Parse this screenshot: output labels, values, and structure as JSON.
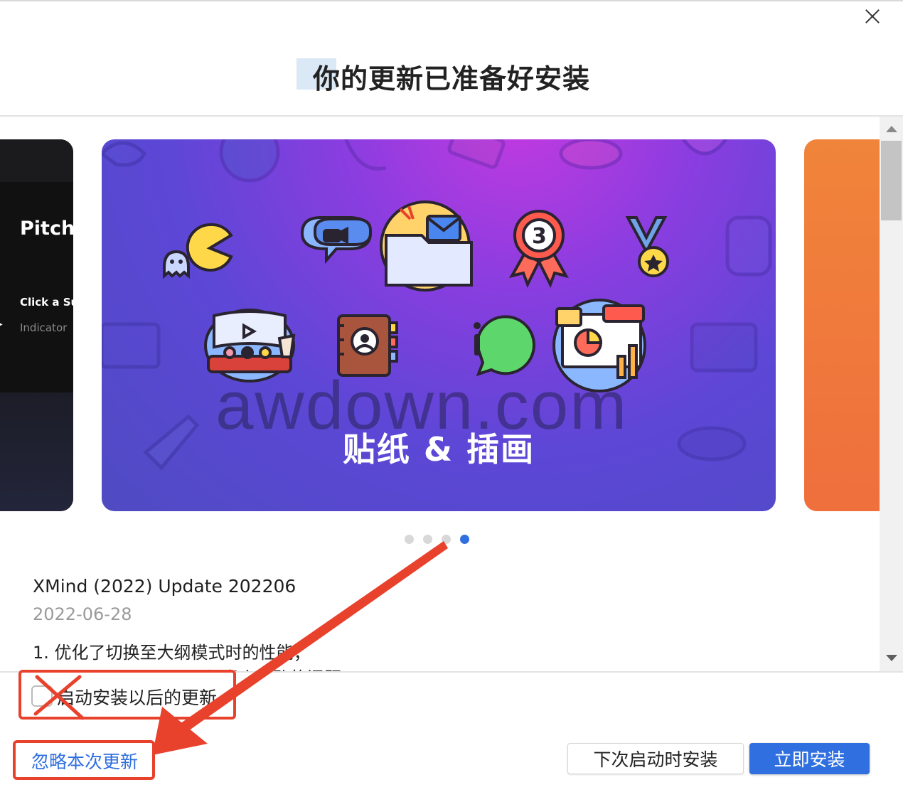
{
  "dialog": {
    "title": "你的更新已准备好安装",
    "close_icon": "close-icon"
  },
  "carousel": {
    "prev_slide": {
      "heading": "Pitch",
      "line1": "Click a Sub",
      "line2": "Indicator"
    },
    "current_slide": {
      "caption": "贴纸 & 插画",
      "stickers": [
        "ghost-icon",
        "pacman-icon",
        "video-chat-icon",
        "folder-mail-icon",
        "medal-3-icon",
        "medal-star-icon",
        "cinema-icon",
        "contacts-book-icon",
        "info-bubble-icon",
        "presentation-chart-icon"
      ]
    },
    "watermark": "awdown.com",
    "page_count": 4,
    "active_page": 4
  },
  "release": {
    "title": "XMind (2022) Update 202206",
    "date": "2022-06-28",
    "note1": "1. 优化了切换至大纲模式时的性能；",
    "note2_partial": "修   当个失败的问题"
  },
  "options": {
    "auto_install_label": "启动安装以后的更新",
    "auto_install_checked": false
  },
  "actions": {
    "ignore_label": "忽略本次更新",
    "later_label": "下次启动时安装",
    "now_label": "立即安装"
  },
  "colors": {
    "accent": "#2f6fe0",
    "annotation": "#e8412c"
  }
}
